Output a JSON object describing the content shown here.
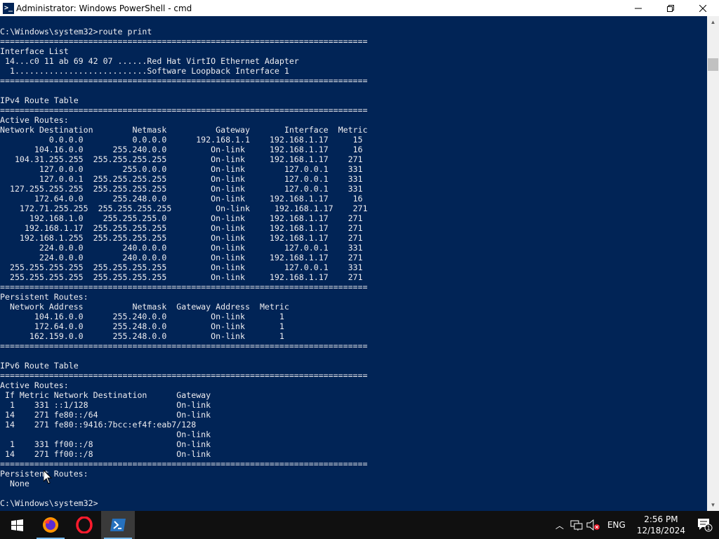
{
  "window": {
    "title": "Administrator: Windows PowerShell - cmd",
    "app_icon": "powershell-icon",
    "minimize_label": "—",
    "maximize_label": "❐",
    "close_label": "✕"
  },
  "console": {
    "text": "C:\\Windows\\system32>route print\n===========================================================================\nInterface List\n 14...c0 11 ab 69 42 07 ......Red Hat VirtIO Ethernet Adapter\n  1...........................Software Loopback Interface 1\n===========================================================================\n\nIPv4 Route Table\n===========================================================================\nActive Routes:\nNetwork Destination        Netmask          Gateway       Interface  Metric\n          0.0.0.0          0.0.0.0      192.168.1.1    192.168.1.17     15\n       104.16.0.0      255.240.0.0         On-link     192.168.1.17     16\n   104.31.255.255  255.255.255.255         On-link     192.168.1.17    271\n        127.0.0.0        255.0.0.0         On-link        127.0.0.1    331\n        127.0.0.1  255.255.255.255         On-link        127.0.0.1    331\n  127.255.255.255  255.255.255.255         On-link        127.0.0.1    331\n       172.64.0.0      255.248.0.0         On-link     192.168.1.17     16\n    172.71.255.255  255.255.255.255         On-link     192.168.1.17    271\n      192.168.1.0    255.255.255.0         On-link     192.168.1.17    271\n     192.168.1.17  255.255.255.255         On-link     192.168.1.17    271\n    192.168.1.255  255.255.255.255         On-link     192.168.1.17    271\n        224.0.0.0        240.0.0.0         On-link        127.0.0.1    331\n        224.0.0.0        240.0.0.0         On-link     192.168.1.17    271\n  255.255.255.255  255.255.255.255         On-link        127.0.0.1    331\n  255.255.255.255  255.255.255.255         On-link     192.168.1.17    271\n===========================================================================\nPersistent Routes:\n  Network Address          Netmask  Gateway Address  Metric\n       104.16.0.0      255.240.0.0         On-link       1\n       172.64.0.0      255.248.0.0         On-link       1\n      162.159.0.0      255.248.0.0         On-link       1\n===========================================================================\n\nIPv6 Route Table\n===========================================================================\nActive Routes:\n If Metric Network Destination      Gateway\n  1    331 ::1/128                  On-link\n 14    271 fe80::/64                On-link\n 14    271 fe80::9416:7bcc:ef4f:eab7/128\n                                    On-link\n  1    331 ff00::/8                 On-link\n 14    271 ff00::/8                 On-link\n===========================================================================\nPersistent Routes:\n  None\n\nC:\\Windows\\system32>"
  },
  "scrollbar": {
    "up_icon": "scroll-up-arrow-icon",
    "down_icon": "scroll-down-arrow-icon",
    "up_glyph": "▲",
    "down_glyph": "▼"
  },
  "taskbar": {
    "items": [
      {
        "name": "start-button",
        "icon": "windows-logo-icon"
      },
      {
        "name": "firefox-taskbar-button",
        "icon": "firefox-icon"
      },
      {
        "name": "opera-taskbar-button",
        "icon": "opera-icon"
      },
      {
        "name": "powershell-taskbar-button",
        "icon": "powershell-icon"
      }
    ],
    "tray": {
      "chevron_glyph": "︿",
      "language": "ENG",
      "time": "2:56 PM",
      "date": "12/18/2024",
      "notification_count": "1"
    }
  },
  "colors": {
    "console_bg": "#012456",
    "console_fg": "#eeedf0",
    "taskbar_bg": "#101010",
    "accent": "#76b9ed"
  }
}
